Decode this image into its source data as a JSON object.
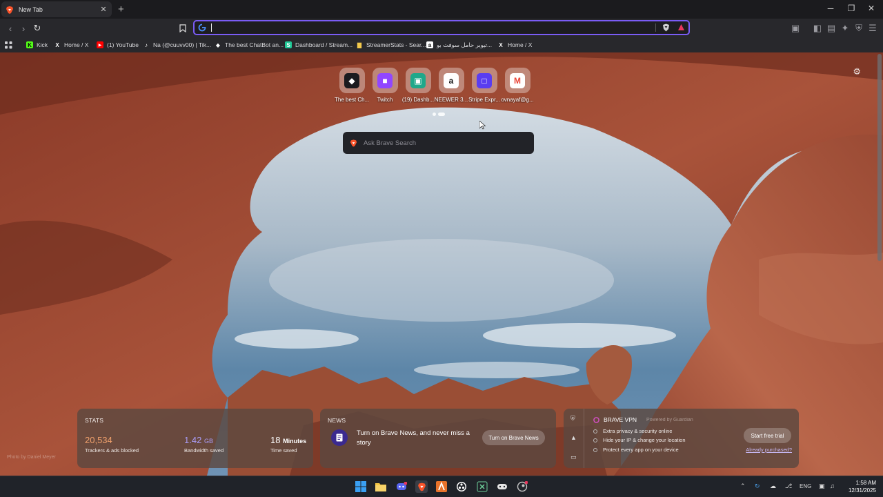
{
  "tab": {
    "title": "New Tab",
    "close": "✕",
    "new_tab": "+"
  },
  "window": {
    "minimize": "─",
    "maximize": "❐",
    "close": "✕"
  },
  "omnibox": {
    "value": "",
    "placeholder": ""
  },
  "bookmarks": [
    {
      "label": "Kick",
      "icon": "kick-icon",
      "color": "#53fc18"
    },
    {
      "label": "Home / X",
      "icon": "x-icon",
      "color": "#000000"
    },
    {
      "label": "(1) YouTube",
      "icon": "youtube-icon",
      "color": "#ff0000"
    },
    {
      "label": "Na (@cuuvv00) | Tik...",
      "icon": "tiktok-icon",
      "color": "#111111"
    },
    {
      "label": "The best ChatBot an...",
      "icon": "chatbot-icon",
      "color": "#ffffff"
    },
    {
      "label": "Dashboard / Stream...",
      "icon": "streamelements-icon",
      "color": "#20c997"
    },
    {
      "label": "StreamerStats - Sear...",
      "icon": "stats-icon",
      "color": "#f2c94c"
    },
    {
      "label": "تيوبر حامل سوفت بو...",
      "icon": "amazon-icon",
      "color": "#ffffff"
    },
    {
      "label": "Home / X",
      "icon": "x-icon",
      "color": "#000000"
    }
  ],
  "top_sites": [
    {
      "label": "The best Ch...",
      "icon": "chatbot-icon",
      "color": "#1b1b1f"
    },
    {
      "label": "Twitch",
      "icon": "twitch-icon",
      "color": "#9146ff"
    },
    {
      "label": "(19) Dashb...",
      "icon": "streamelements-icon",
      "color": "#1fa88a"
    },
    {
      "label": "NEEWER 3...",
      "icon": "amazon-icon",
      "color": "#ffffff"
    },
    {
      "label": "Stripe Expr...",
      "icon": "stripe-icon",
      "color": "#5a3df0"
    },
    {
      "label": "ovnayaf@g...",
      "icon": "gmail-icon",
      "color": "#ffffff"
    }
  ],
  "search": {
    "placeholder": "Ask Brave Search"
  },
  "stats": {
    "heading": "STATS",
    "trackers_value": "20,534",
    "trackers_label": "Trackers & ads blocked",
    "bandwidth_value": "1.42",
    "bandwidth_unit": "GB",
    "bandwidth_label": "Bandwidth saved",
    "time_value": "18",
    "time_unit": "Minutes",
    "time_label": "Time saved"
  },
  "news": {
    "heading": "NEWS",
    "text": "Turn on Brave News, and never miss a story",
    "button": "Turn on Brave News"
  },
  "vpn": {
    "title": "BRAVE VPN",
    "powered": "Powered by Guardian",
    "features": [
      "Extra privacy & security online",
      "Hide your IP & change your location",
      "Protect every app on your device"
    ],
    "cta": "Start free trial",
    "purchased": "Already purchased?"
  },
  "photo_credit": "Photo by Daniel Meyer",
  "taskbar": {
    "lang": "ENG",
    "time": "1:58 AM",
    "date": "12/31/2025"
  },
  "colors": {
    "accent": "#7a5cf5",
    "trackers": "#f0a06c",
    "bandwidth": "#a99cf5"
  }
}
